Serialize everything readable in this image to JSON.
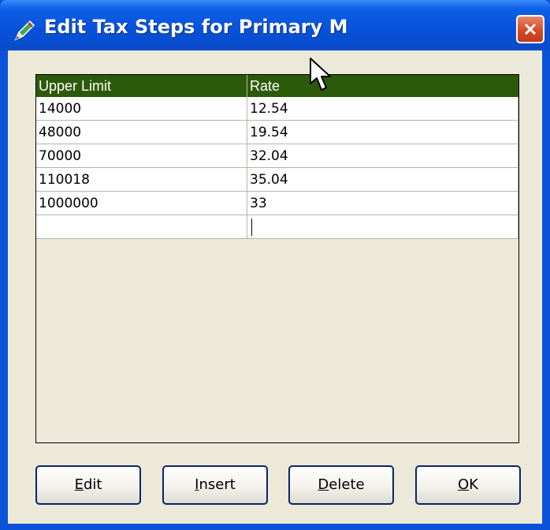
{
  "window": {
    "title": "Edit Tax Steps for Primary M"
  },
  "grid": {
    "columns": [
      "Upper Limit",
      "Rate"
    ],
    "rows": [
      [
        "14000",
        "12.54"
      ],
      [
        "48000",
        "19.54"
      ],
      [
        "70000",
        "32.04"
      ],
      [
        "110018",
        "35.04"
      ],
      [
        "1000000",
        "33"
      ],
      [
        "",
        ""
      ]
    ],
    "header_color": "#2d5a0a"
  },
  "buttons": [
    {
      "mnemonic": "E",
      "rest": "dit"
    },
    {
      "mnemonic": "I",
      "rest": "nsert"
    },
    {
      "mnemonic": "D",
      "rest": "elete"
    },
    {
      "mnemonic": "O",
      "rest": "K"
    }
  ],
  "icons": {
    "title_icon": "pencil-icon",
    "close": "close-icon",
    "cursor": "mouse-pointer-icon"
  }
}
